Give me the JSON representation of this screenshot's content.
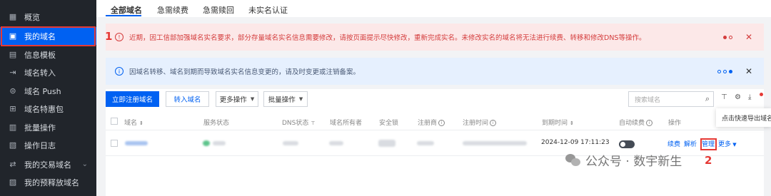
{
  "sidebar": {
    "items": [
      {
        "label": "概览",
        "icon": "grid-icon"
      },
      {
        "label": "我的域名",
        "icon": "domain-icon",
        "active": true
      },
      {
        "label": "信息模板",
        "icon": "template-icon"
      },
      {
        "label": "域名转入",
        "icon": "transfer-in-icon"
      },
      {
        "label": "域名 Push",
        "icon": "push-icon"
      },
      {
        "label": "域名特惠包",
        "icon": "package-icon"
      },
      {
        "label": "批量操作",
        "icon": "batch-icon"
      },
      {
        "label": "操作日志",
        "icon": "log-icon"
      },
      {
        "label": "我的交易域名",
        "icon": "trade-icon",
        "expandable": true
      },
      {
        "label": "我的预释放域名",
        "icon": "release-icon"
      }
    ]
  },
  "tabs": [
    "全部域名",
    "急需续费",
    "急需赎回",
    "未实名认证"
  ],
  "alerts": {
    "red": {
      "text": "近期，因工信部加强域名实名要求，部分存量域名实名信息需要修改，请按页面提示尽快修改，重新完成实名。未修改实名的域名将无法进行续费、转移和修改DNS等操作。",
      "close": "✕"
    },
    "blue": {
      "text": "因域名转移、域名到期而导致域名实名信息变更的，请及时变更或注销备案。",
      "close": "✕"
    }
  },
  "annotations": {
    "label1": "1",
    "label2": "2"
  },
  "toolbar": {
    "register": "立即注册域名",
    "transfer": "转入域名",
    "more_ops": "更多操作",
    "batch_ops": "批量操作",
    "search_placeholder": "搜索域名",
    "tooltip": "点击快速导出域名列表"
  },
  "table": {
    "headers": {
      "domain": "域名",
      "service_status": "服务状态",
      "dns_status": "DNS状态",
      "owner": "域名所有者",
      "lock": "安全锁",
      "registrar": "注册商",
      "reg_time": "注册时间",
      "expire": "到期时间",
      "auto_renew": "自动续费",
      "actions": "操作"
    },
    "row": {
      "expire": "2024-12-09 17:11:23",
      "renew": "续费",
      "resolve": "解析",
      "manage": "管理",
      "more": "更多"
    }
  },
  "watermark": {
    "text": "公众号 · 数宇新生"
  },
  "colors": {
    "accent": "#0061f2",
    "alert_red": "#d43c3c",
    "sidebar_bg": "#21252b"
  }
}
